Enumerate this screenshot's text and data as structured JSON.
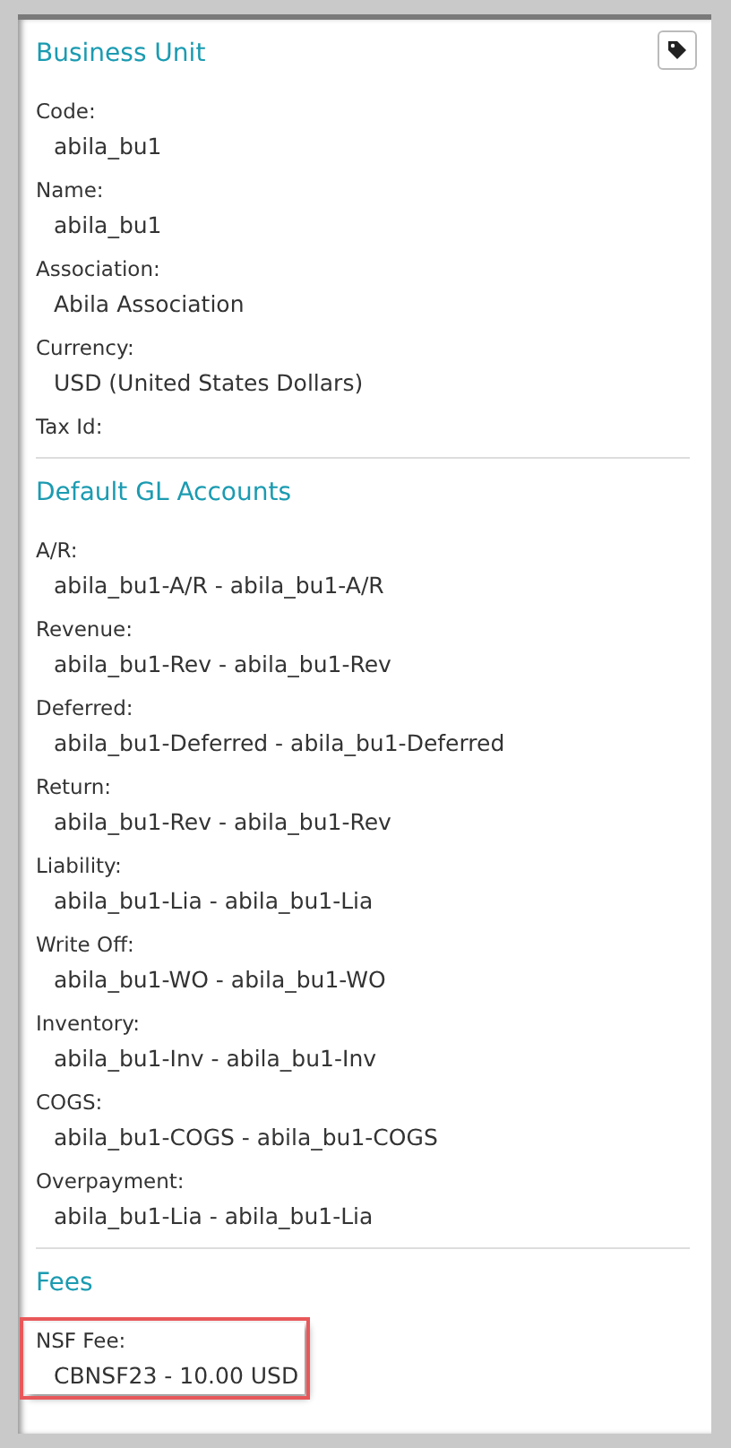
{
  "sections": [
    {
      "title": "Business Unit",
      "tag_button": true,
      "fields": [
        {
          "label": "Code:",
          "value": "abila_bu1"
        },
        {
          "label": "Name:",
          "value": "abila_bu1"
        },
        {
          "label": "Association:",
          "value": "Abila Association"
        },
        {
          "label": "Currency:",
          "value": "USD (United States Dollars)"
        },
        {
          "label": "Tax Id:"
        }
      ]
    },
    {
      "title": "Default GL Accounts",
      "fields": [
        {
          "label": "A/R:",
          "value": "abila_bu1-A/R - abila_bu1-A/R"
        },
        {
          "label": "Revenue:",
          "value": "abila_bu1-Rev - abila_bu1-Rev"
        },
        {
          "label": "Deferred:",
          "value": "abila_bu1-Deferred - abila_bu1-Deferred"
        },
        {
          "label": "Return:",
          "value": "abila_bu1-Rev - abila_bu1-Rev"
        },
        {
          "label": "Liability:",
          "value": "abila_bu1-Lia - abila_bu1-Lia"
        },
        {
          "label": "Write Off:",
          "value": "abila_bu1-WO - abila_bu1-WO"
        },
        {
          "label": "Inventory:",
          "value": "abila_bu1-Inv - abila_bu1-Inv"
        },
        {
          "label": "COGS:",
          "value": "abila_bu1-COGS - abila_bu1-COGS"
        },
        {
          "label": "Overpayment:",
          "value": "abila_bu1-Lia - abila_bu1-Lia"
        }
      ]
    },
    {
      "title": "Fees",
      "fields": [
        {
          "label": "NSF Fee:",
          "value": "CBNSF23 - 10.00 USD",
          "highlighted": true
        }
      ]
    }
  ]
}
